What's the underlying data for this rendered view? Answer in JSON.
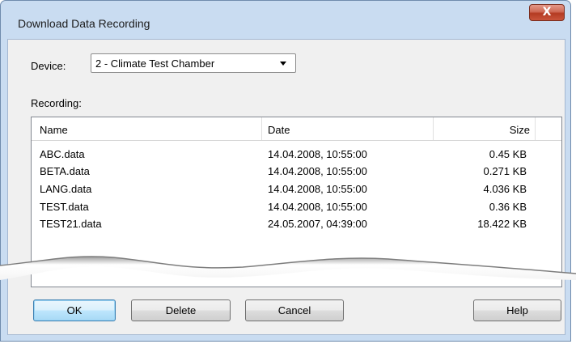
{
  "window": {
    "title": "Download Data Recording",
    "close_glyph": "X"
  },
  "device": {
    "label": "Device:",
    "selected": "2 - Climate Test Chamber"
  },
  "recording": {
    "label": "Recording:",
    "columns": {
      "name": "Name",
      "date": "Date",
      "size": "Size"
    },
    "rows": [
      {
        "name": "ABC.data",
        "date": "14.04.2008, 10:55:00",
        "size": "0.45 KB"
      },
      {
        "name": "BETA.data",
        "date": "14.04.2008, 10:55:00",
        "size": "0.271 KB"
      },
      {
        "name": "LANG.data",
        "date": "14.04.2008, 10:55:00",
        "size": "4.036 KB"
      },
      {
        "name": "TEST.data",
        "date": "14.04.2008, 10:55:00",
        "size": "0.36 KB"
      },
      {
        "name": "TEST21.data",
        "date": "24.05.2007, 04:39:00",
        "size": "18.422 KB"
      }
    ]
  },
  "buttons": {
    "ok": "OK",
    "delete": "Delete",
    "cancel": "Cancel",
    "help": "Help"
  }
}
